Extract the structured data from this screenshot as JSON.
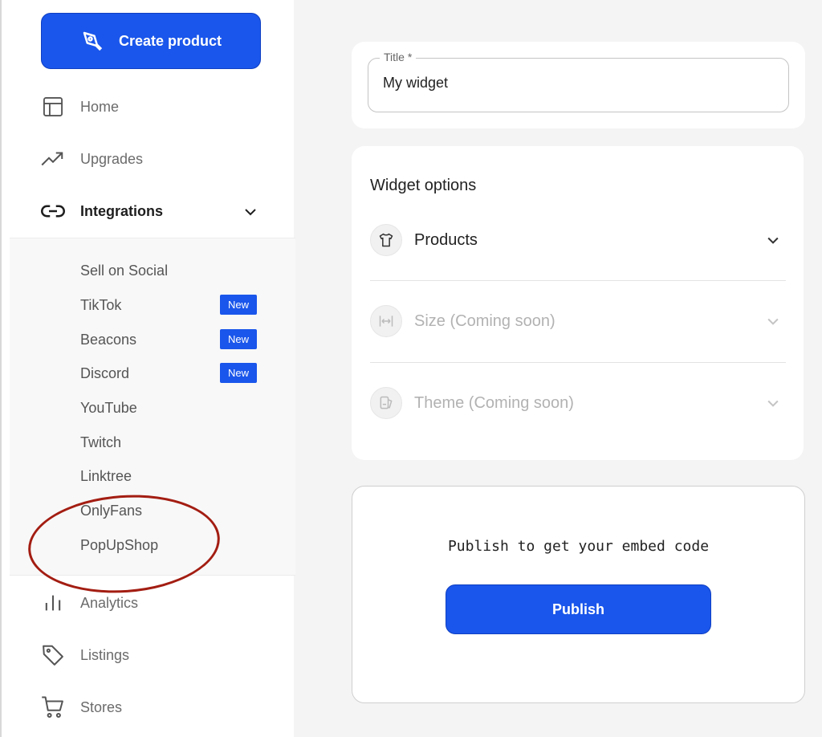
{
  "sidebar": {
    "create_button": {
      "label": "Create product",
      "icon": "pen-tool-icon"
    },
    "items": [
      {
        "label": "Home",
        "icon": "layout-icon"
      },
      {
        "label": "Upgrades",
        "icon": "trending-up-icon"
      },
      {
        "label": "Integrations",
        "icon": "link-icon"
      },
      {
        "label": "Analytics",
        "icon": "bar-chart-icon"
      },
      {
        "label": "Listings",
        "icon": "tag-icon"
      },
      {
        "label": "Stores",
        "icon": "cart-icon"
      }
    ],
    "integrations_sub": [
      {
        "label": "Sell on Social"
      },
      {
        "label": "TikTok",
        "badge": "New"
      },
      {
        "label": "Beacons",
        "badge": "New"
      },
      {
        "label": "Discord",
        "badge": "New"
      },
      {
        "label": "YouTube"
      },
      {
        "label": "Twitch"
      },
      {
        "label": "Linktree"
      },
      {
        "label": "OnlyFans"
      },
      {
        "label": "PopUpShop"
      }
    ]
  },
  "main": {
    "title_field": {
      "label": "Title *",
      "value": "My widget"
    },
    "widget_options": {
      "heading": "Widget options",
      "options": [
        {
          "label": "Products",
          "icon": "tshirt-icon"
        },
        {
          "label": "Size (Coming soon)",
          "icon": "resize-icon"
        },
        {
          "label": "Theme (Coming soon)",
          "icon": "palette-icon"
        }
      ]
    },
    "publish": {
      "text": "Publish to get your embed code",
      "button_label": "Publish"
    }
  },
  "colors": {
    "accent": "#1a56eb",
    "annotation": "#a31d12"
  }
}
